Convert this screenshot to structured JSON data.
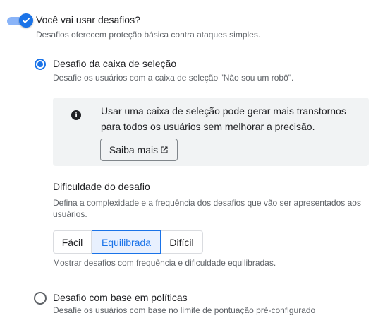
{
  "challenge_toggle": {
    "enabled": true,
    "title": "Você vai usar desafios?",
    "subtitle": "Desafios oferecem proteção básica contra ataques simples."
  },
  "options": [
    {
      "title": "Desafio da caixa de seleção",
      "description": "Desafie os usuários com a caixa de seleção \"Não sou um robô\".",
      "selected": true
    },
    {
      "title": "Desafio com base em políticas",
      "description": "Desafie os usuários com base no limite de pontuação pré-configurado",
      "selected": false
    }
  ],
  "info": {
    "icon": "info-icon",
    "text": "Usar uma caixa de seleção pode gerar mais transtornos para todos os usuários sem melhorar a precisão.",
    "learn_more_label": "Saiba mais",
    "learn_more_icon": "open-in-new-icon"
  },
  "difficulty": {
    "title": "Dificuldade do desafio",
    "description": "Defina a complexidade e a frequência dos desafios que vão ser apresentados aos usuários.",
    "levels": [
      "Fácil",
      "Equilibrada",
      "Difícil"
    ],
    "selected": "Equilibrada",
    "note": "Mostrar desafios com frequência e dificuldade equilibradas."
  },
  "colors": {
    "accent": "#1a73e8",
    "accent_light": "#8ab4f8",
    "selected_bg": "#e8f0fe",
    "info_bg": "#f1f3f4",
    "secondary_text": "#5f6368"
  }
}
